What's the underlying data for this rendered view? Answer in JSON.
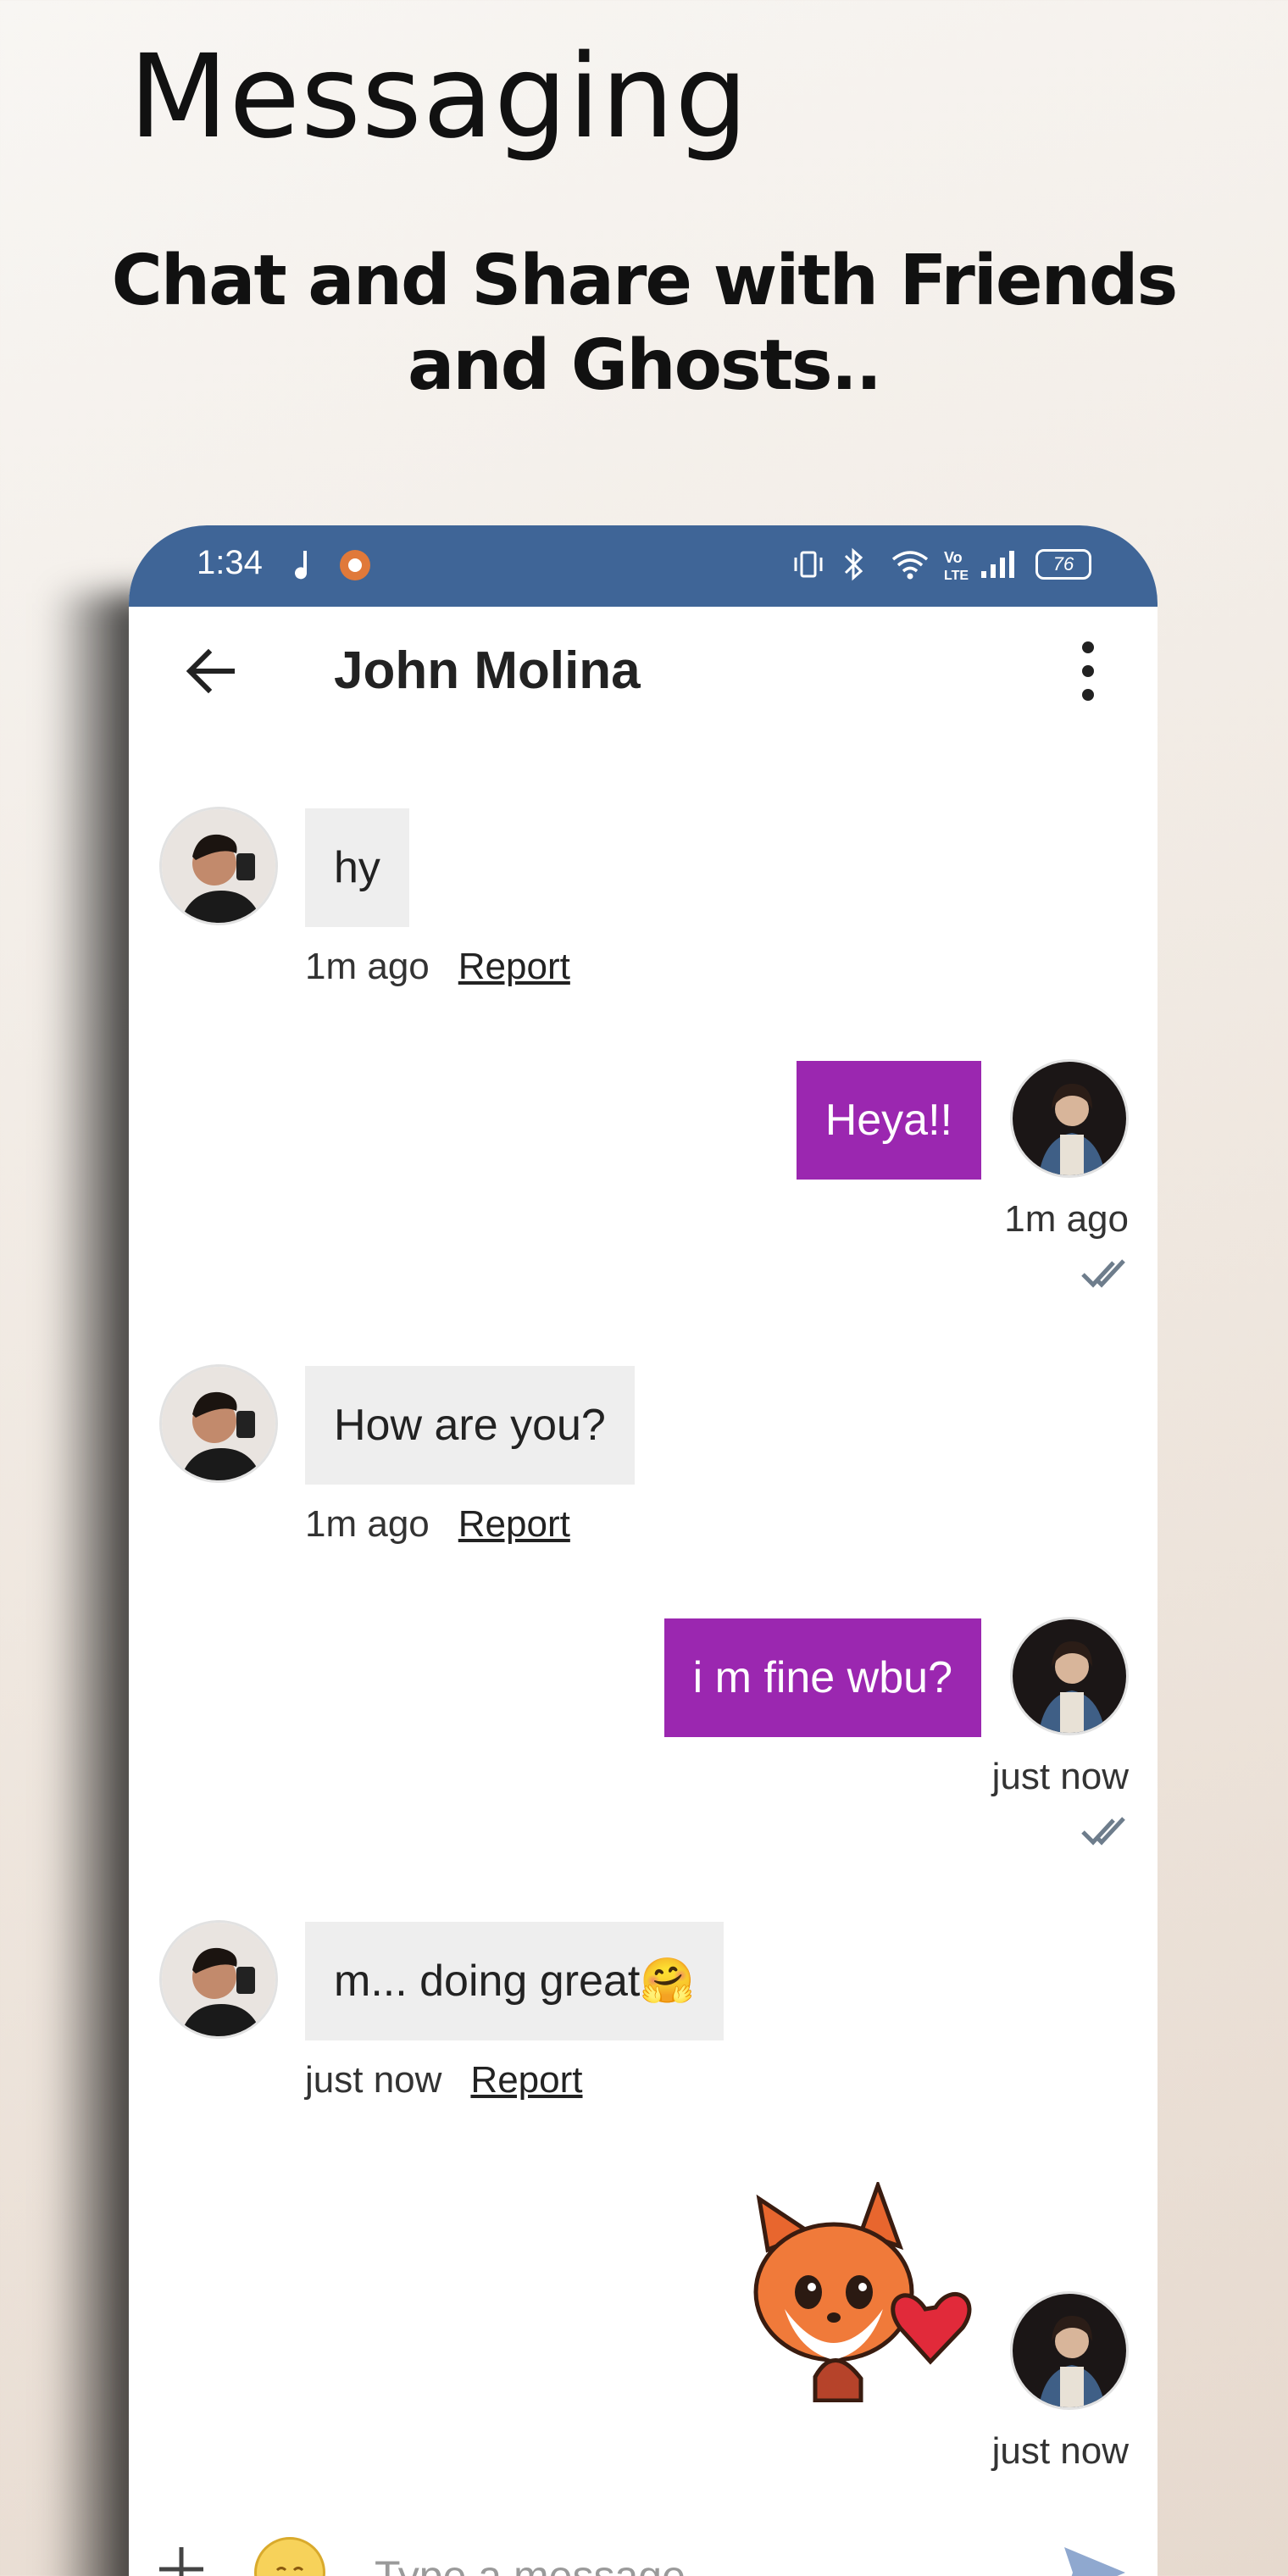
{
  "promo": {
    "title": "Messaging",
    "subtitle": "Chat and Share with Friends and Ghosts.."
  },
  "status_bar": {
    "time": "1:34",
    "battery": "76",
    "icons": [
      "music-note-icon",
      "app-notification-icon",
      "vibrate-icon",
      "bluetooth-icon",
      "wifi-icon",
      "volte-icon",
      "signal-icon",
      "battery-icon"
    ]
  },
  "chat": {
    "contact_name": "John Molina",
    "report_label": "Report",
    "messages": [
      {
        "side": "in",
        "text": "hy",
        "time": "1m ago"
      },
      {
        "side": "out",
        "text": "Heya!!",
        "time": "1m ago"
      },
      {
        "side": "in",
        "text": "How are you?",
        "time": "1m ago"
      },
      {
        "side": "out",
        "text": "i m fine wbu?",
        "time": "just now"
      },
      {
        "side": "in",
        "text": "m... doing great🤗",
        "time": "just now"
      },
      {
        "side": "out",
        "sticker": "fox-heart-sticker",
        "time": "just now"
      }
    ]
  },
  "composer": {
    "placeholder": "Type a message..."
  },
  "colors": {
    "status_bar": "#3f6597",
    "outgoing_bubble": "#9b27b0",
    "incoming_bubble": "#eeeeee",
    "send_icon": "#8fa8cf"
  }
}
